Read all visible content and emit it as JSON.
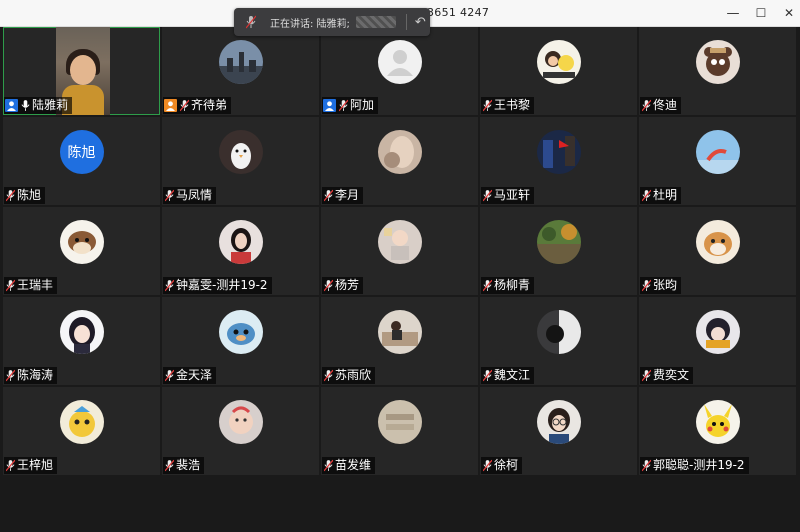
{
  "window": {
    "meeting_id": "3651 4247",
    "controls": {
      "minimize": "—",
      "maximize": "☐",
      "close": "✕"
    }
  },
  "speaker_banner": {
    "label": "正在讲话: 陆雅莉;",
    "mic_icon": "mic-muted-icon",
    "back_icon": "return-arrow-icon"
  },
  "accent_colors": {
    "host_blue": "#1f6fe0",
    "cohost_orange": "#f08a24",
    "active_green": "#2e9c4a"
  },
  "participants": [
    {
      "name": "陆雅莉",
      "badge": "host",
      "mic": "on",
      "video": "live-camera"
    },
    {
      "name": "齐待弟",
      "badge": "cohost",
      "mic": "muted",
      "avatar": "cityscape-photo"
    },
    {
      "name": "阿加",
      "badge": "host",
      "mic": "muted",
      "avatar": "default-user"
    },
    {
      "name": "王书黎",
      "badge": "",
      "mic": "muted",
      "avatar": "cartoon-photo"
    },
    {
      "name": "佟迪",
      "badge": "",
      "mic": "muted",
      "avatar": "cartoon-bear"
    },
    {
      "name": "陈旭",
      "badge": "",
      "mic": "muted",
      "avatar_text": "陈旭"
    },
    {
      "name": "马凤情",
      "badge": "",
      "mic": "muted",
      "avatar": "white-bird"
    },
    {
      "name": "李月",
      "badge": "",
      "mic": "muted",
      "avatar": "blurry-photo"
    },
    {
      "name": "马亚轩",
      "badge": "",
      "mic": "muted",
      "avatar": "christmas-photo"
    },
    {
      "name": "杜明",
      "badge": "",
      "mic": "muted",
      "avatar": "sky-photo"
    },
    {
      "name": "王瑞丰",
      "badge": "",
      "mic": "muted",
      "avatar": "cartoon-dog"
    },
    {
      "name": "钟嘉雯-测井19-2",
      "badge": "",
      "mic": "muted",
      "avatar": "portrait-photo"
    },
    {
      "name": "杨芳",
      "badge": "",
      "mic": "muted",
      "avatar": "child-photo"
    },
    {
      "name": "杨柳青",
      "badge": "",
      "mic": "muted",
      "avatar": "street-photo"
    },
    {
      "name": "张昀",
      "badge": "",
      "mic": "muted",
      "avatar": "shiba-dog"
    },
    {
      "name": "陈海涛",
      "badge": "",
      "mic": "muted",
      "avatar": "anime-girl"
    },
    {
      "name": "金天泽",
      "badge": "",
      "mic": "muted",
      "avatar": "cartoon-cat"
    },
    {
      "name": "苏雨欣",
      "badge": "",
      "mic": "muted",
      "avatar": "room-photo"
    },
    {
      "name": "魏文江",
      "badge": "",
      "mic": "muted",
      "avatar": "dark-photo"
    },
    {
      "name": "费奕文",
      "badge": "",
      "mic": "muted",
      "avatar": "anime-boy"
    },
    {
      "name": "王梓旭",
      "badge": "",
      "mic": "muted",
      "avatar": "cartoon-character"
    },
    {
      "name": "裴浩",
      "badge": "",
      "mic": "muted",
      "avatar": "baby-photo"
    },
    {
      "name": "苗发维",
      "badge": "",
      "mic": "muted",
      "avatar": "fabric-photo"
    },
    {
      "name": "徐柯",
      "badge": "",
      "mic": "muted",
      "avatar": "anime-detective"
    },
    {
      "name": "郭聪聪-测井19-2",
      "badge": "",
      "mic": "muted",
      "avatar": "pikachu"
    }
  ]
}
